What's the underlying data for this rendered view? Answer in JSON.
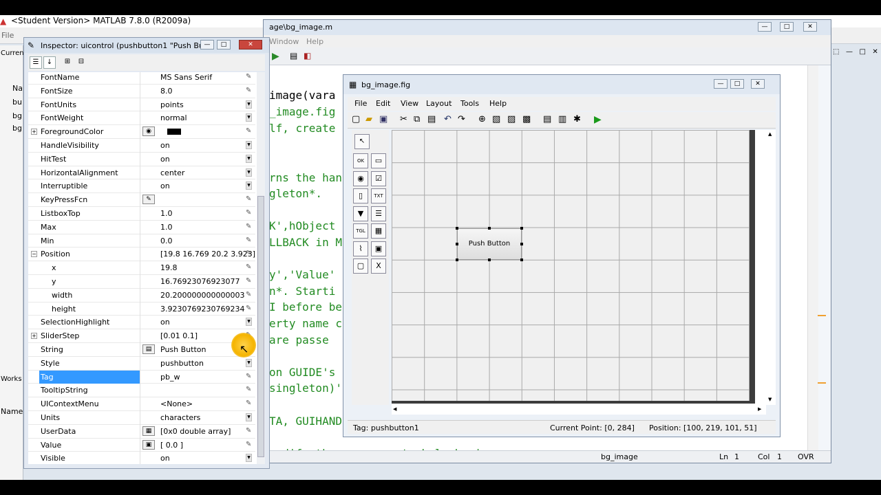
{
  "matlab": {
    "title": "<Student Version> MATLAB  7.8.0 (R2009a)",
    "menu_file": "File",
    "left_tabs": [
      "Curren",
      "Na",
      "bu",
      "bg",
      "bg",
      "Works",
      "Name"
    ]
  },
  "editor": {
    "title": "age\\bg_image.m",
    "menu": {
      "window": "Window",
      "help": "Help"
    },
    "code_lines": [
      "image(vara",
      "_image.fig",
      "lf, create",
      "rns the han",
      "gleton*.",
      "K',hObject",
      "LLBACK in M",
      "y','Value'",
      "n*.  Starti",
      "I before be",
      "erty name c",
      " are passe",
      "on GUIDE's",
      "singleton)'",
      "TA, GUIHAND",
      " modify the response to help bg_image"
    ],
    "status": {
      "file": "bg_image",
      "ln_label": "Ln",
      "ln": "1",
      "col_label": "Col",
      "col": "1",
      "mode": "OVR"
    }
  },
  "inspector": {
    "title": "Inspector:  uicontrol (pushbutton1 \"Push Bu...",
    "properties": [
      {
        "name": "FontName",
        "value": "MS Sans Serif"
      },
      {
        "name": "FontSize",
        "value": "8.0"
      },
      {
        "name": "FontUnits",
        "value": "points"
      },
      {
        "name": "FontWeight",
        "value": "normal"
      },
      {
        "name": "ForegroundColor",
        "value": ""
      },
      {
        "name": "HandleVisibility",
        "value": "on"
      },
      {
        "name": "HitTest",
        "value": "on"
      },
      {
        "name": "HorizontalAlignment",
        "value": "center"
      },
      {
        "name": "Interruptible",
        "value": "on"
      },
      {
        "name": "KeyPressFcn",
        "value": ""
      },
      {
        "name": "ListboxTop",
        "value": "1.0"
      },
      {
        "name": "Max",
        "value": "1.0"
      },
      {
        "name": "Min",
        "value": "0.0"
      },
      {
        "name": "Position",
        "value": "[19.8 16.769 20.2 3.923]"
      },
      {
        "name": "x",
        "value": "19.8"
      },
      {
        "name": "y",
        "value": "16.76923076923077"
      },
      {
        "name": "width",
        "value": "20.200000000000003"
      },
      {
        "name": "height",
        "value": "3.9230769230769234"
      },
      {
        "name": "SelectionHighlight",
        "value": "on"
      },
      {
        "name": "SliderStep",
        "value": "[0.01 0.1]"
      },
      {
        "name": "String",
        "value": "Push Button"
      },
      {
        "name": "Style",
        "value": "pushbutton"
      },
      {
        "name": "Tag",
        "value": "pb_w"
      },
      {
        "name": "TooltipString",
        "value": ""
      },
      {
        "name": "UIContextMenu",
        "value": "<None>"
      },
      {
        "name": "Units",
        "value": "characters"
      },
      {
        "name": "UserData",
        "value": "[0x0  double array]"
      },
      {
        "name": "Value",
        "value": "[ 0.0 ]"
      },
      {
        "name": "Visible",
        "value": "on"
      }
    ]
  },
  "guide": {
    "title": "bg_image.fig",
    "menu": [
      "File",
      "Edit",
      "View",
      "Layout",
      "Tools",
      "Help"
    ],
    "push_button_label": "Push Button",
    "palette": [
      "OK",
      "slider",
      "radio",
      "check",
      "edit",
      "text",
      "popup",
      "listbox",
      "toggle",
      "table",
      "axes",
      "panel",
      "group",
      "activex"
    ],
    "status": {
      "tag": "Tag: pushbutton1",
      "current_point": "Current Point:  [0, 284]",
      "position": "Position: [100, 219, 101, 51]"
    }
  },
  "colors": {
    "selection": "#3399ff",
    "code_comment": "#228b22",
    "close_button": "#c9463d",
    "cursor_highlight": "#f5b400"
  }
}
